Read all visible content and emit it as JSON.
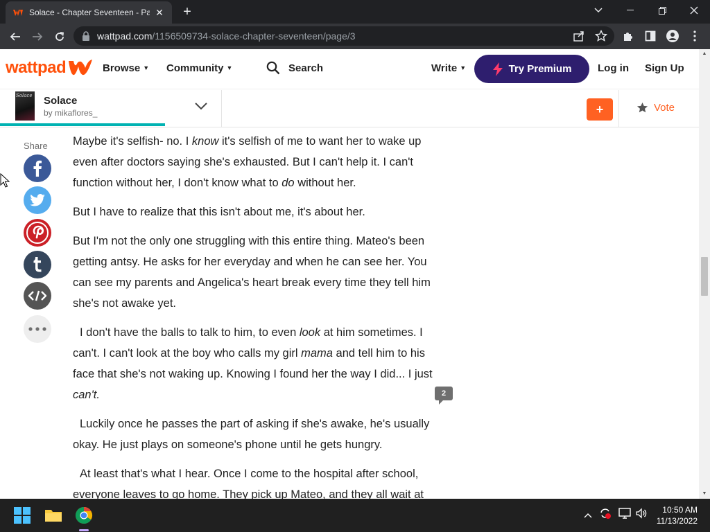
{
  "browser": {
    "tab_title": "Solace - Chapter Seventeen - Pag",
    "tab_close": "✕",
    "new_tab": "+",
    "url_host": "wattpad.com",
    "url_path": "/1156509734-solace-chapter-seventeen/page/3"
  },
  "header": {
    "logo_text": "wattpad",
    "browse": "Browse",
    "community": "Community",
    "search": "Search",
    "write": "Write",
    "premium": "Try Premium",
    "login": "Log in",
    "signup": "Sign Up"
  },
  "storybar": {
    "cover_text": "Solace",
    "title": "Solace",
    "author": "by mikaflores_",
    "add": "+",
    "vote": "Vote"
  },
  "share": {
    "label": "Share"
  },
  "story": {
    "p1_a": "Maybe it's selfish- no. I ",
    "p1_em1": "know",
    "p1_b": " it's selfish of me to want her to wake up even after doctors saying she's exhausted. But I can't help it. I can't function without her, I don't know what to ",
    "p1_em2": "do",
    "p1_c": " without her.",
    "p2": "But I have to realize that this isn't about me, it's about her.",
    "p3": "But I'm not the only one struggling with this entire thing. Mateo's been getting antsy. He asks for her everyday and when he can see her. You can see my parents and Angelica's heart break every time they tell him she's not awake yet.",
    "p4_a": "I don't have the balls to talk to him, to even ",
    "p4_em1": "look",
    "p4_b": " at him sometimes. I can't. I can't look at the boy who calls my girl ",
    "p4_em2": "mama",
    "p4_c": " and tell him to his face that she's not waking up. Knowing I found her the way I did... I just ",
    "p4_em3": "can't.",
    "p5": "Luckily once he passes the part of asking if she's awake, he's usually okay. He just plays on someone's phone until he gets hungry.",
    "p6": "At least that's what I hear. Once I come to the hospital after school, everyone leaves to go home. They pick up Mateo, and they all wait at",
    "comment_count": "2"
  },
  "taskbar": {
    "time": "10:50 AM",
    "date": "11/13/2022"
  },
  "colors": {
    "brand": "#ff500a",
    "premium": "#2e1e6e",
    "progress": "#00b2b2",
    "facebook": "#3b5998",
    "twitter": "#55acee",
    "pinterest": "#cb2027",
    "tumblr": "#35465c",
    "embed": "#555555"
  }
}
